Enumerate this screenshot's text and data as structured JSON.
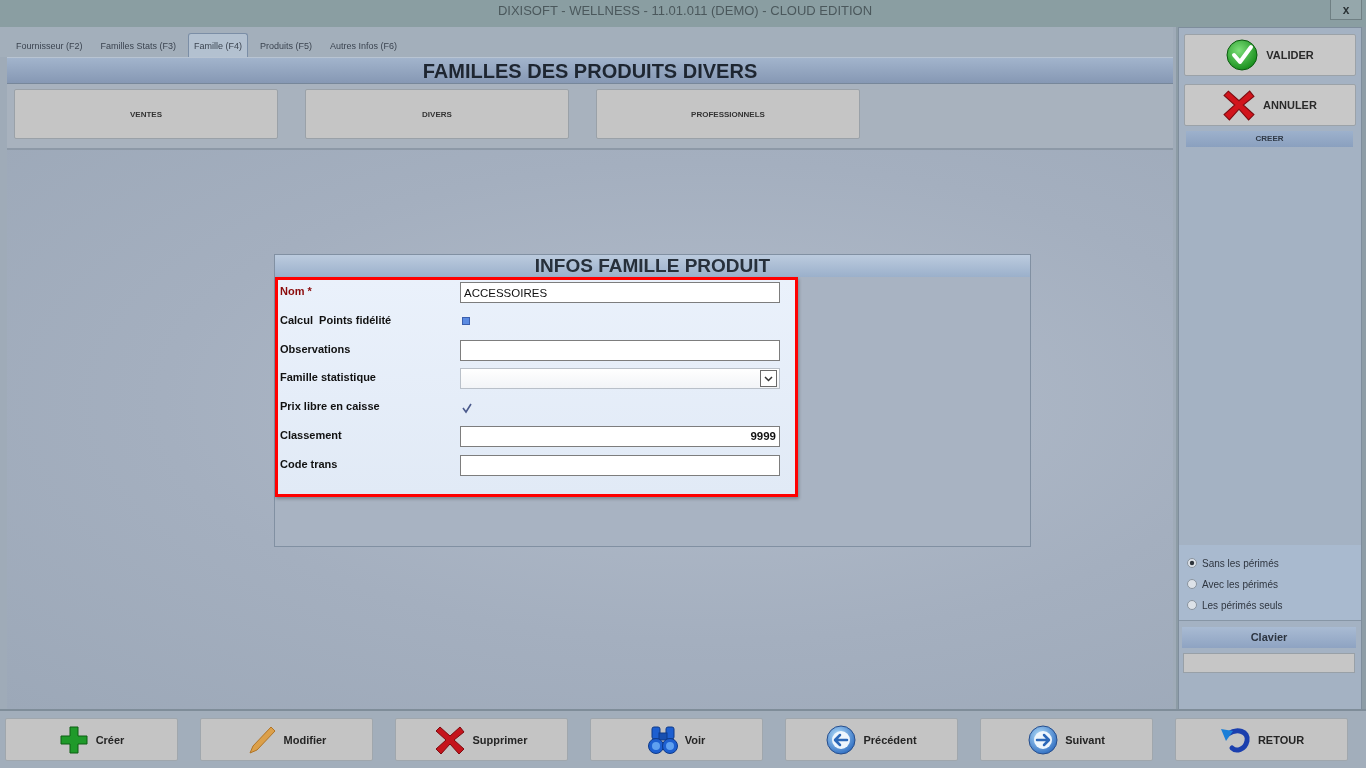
{
  "window": {
    "title": "DIXISOFT - WELLNESS - 11.01.011 (DEMO) - CLOUD EDITION",
    "close_label": "x"
  },
  "tabs": [
    {
      "label": "Fournisseur (F2)",
      "selected": false
    },
    {
      "label": "Familles Stats (F3)",
      "selected": false
    },
    {
      "label": "Famille (F4)",
      "selected": true
    },
    {
      "label": "Produits (F5)",
      "selected": false
    },
    {
      "label": "Autres Infos (F6)",
      "selected": false
    }
  ],
  "header": {
    "title": "FAMILLES DES PRODUITS DIVERS"
  },
  "family_buttons": [
    {
      "label": "VENTES"
    },
    {
      "label": "DIVERS"
    },
    {
      "label": "PROFESSIONNELS"
    }
  ],
  "form": {
    "title": "INFOS FAMILLE PRODUIT",
    "fields": [
      {
        "kind": "text",
        "label": "Nom *",
        "required": true,
        "value": "ACCESSOIRES"
      },
      {
        "kind": "checkbox",
        "label": "Calcul  Points fidélité",
        "required": false,
        "checked": false
      },
      {
        "kind": "text",
        "label": "Observations",
        "required": false
      },
      {
        "kind": "select",
        "label": "Famille statistique",
        "required": false
      },
      {
        "kind": "checkbox",
        "label": "Prix libre en caisse",
        "required": false,
        "checked": true
      },
      {
        "kind": "number",
        "label": "Classement",
        "required": false,
        "value": "9999"
      },
      {
        "kind": "text",
        "label": "Code trans",
        "required": false
      }
    ]
  },
  "side_panel": {
    "actions": [
      {
        "kind": "validate",
        "label": "VALIDER"
      },
      {
        "kind": "cancel",
        "label": "ANNULER"
      }
    ],
    "section_title": "CREER",
    "filter_options": [
      {
        "label": "Sans les périmés",
        "selected": true
      },
      {
        "label": "Avec les périmés",
        "selected": false
      },
      {
        "label": "Les périmés seuls",
        "selected": false
      }
    ],
    "keyboard": {
      "title": "Clavier"
    }
  },
  "toolbar": [
    {
      "kind": "create",
      "label": "Créer"
    },
    {
      "kind": "edit",
      "label": "Modifier"
    },
    {
      "kind": "delete",
      "label": "Supprimer"
    },
    {
      "kind": "view",
      "label": "Voir"
    },
    {
      "kind": "previous",
      "label": "Précédent"
    },
    {
      "kind": "next",
      "label": "Suivant"
    },
    {
      "kind": "back",
      "label": "RETOUR"
    }
  ]
}
